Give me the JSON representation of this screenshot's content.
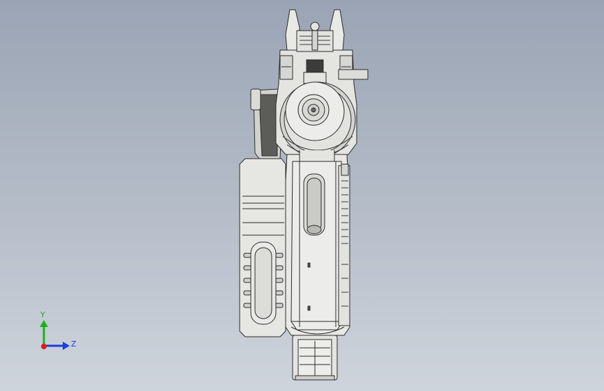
{
  "triad": {
    "y_label": "Y",
    "z_label": "Z",
    "y_color": "#19b319",
    "z_color": "#1c3fd8",
    "x_color": "#e01c1c"
  },
  "colors": {
    "model_fill": "#e7e7e3",
    "model_stroke": "#2b2b2b",
    "model_shade": "#c9c9c4",
    "model_dark": "#8e8e8a"
  }
}
